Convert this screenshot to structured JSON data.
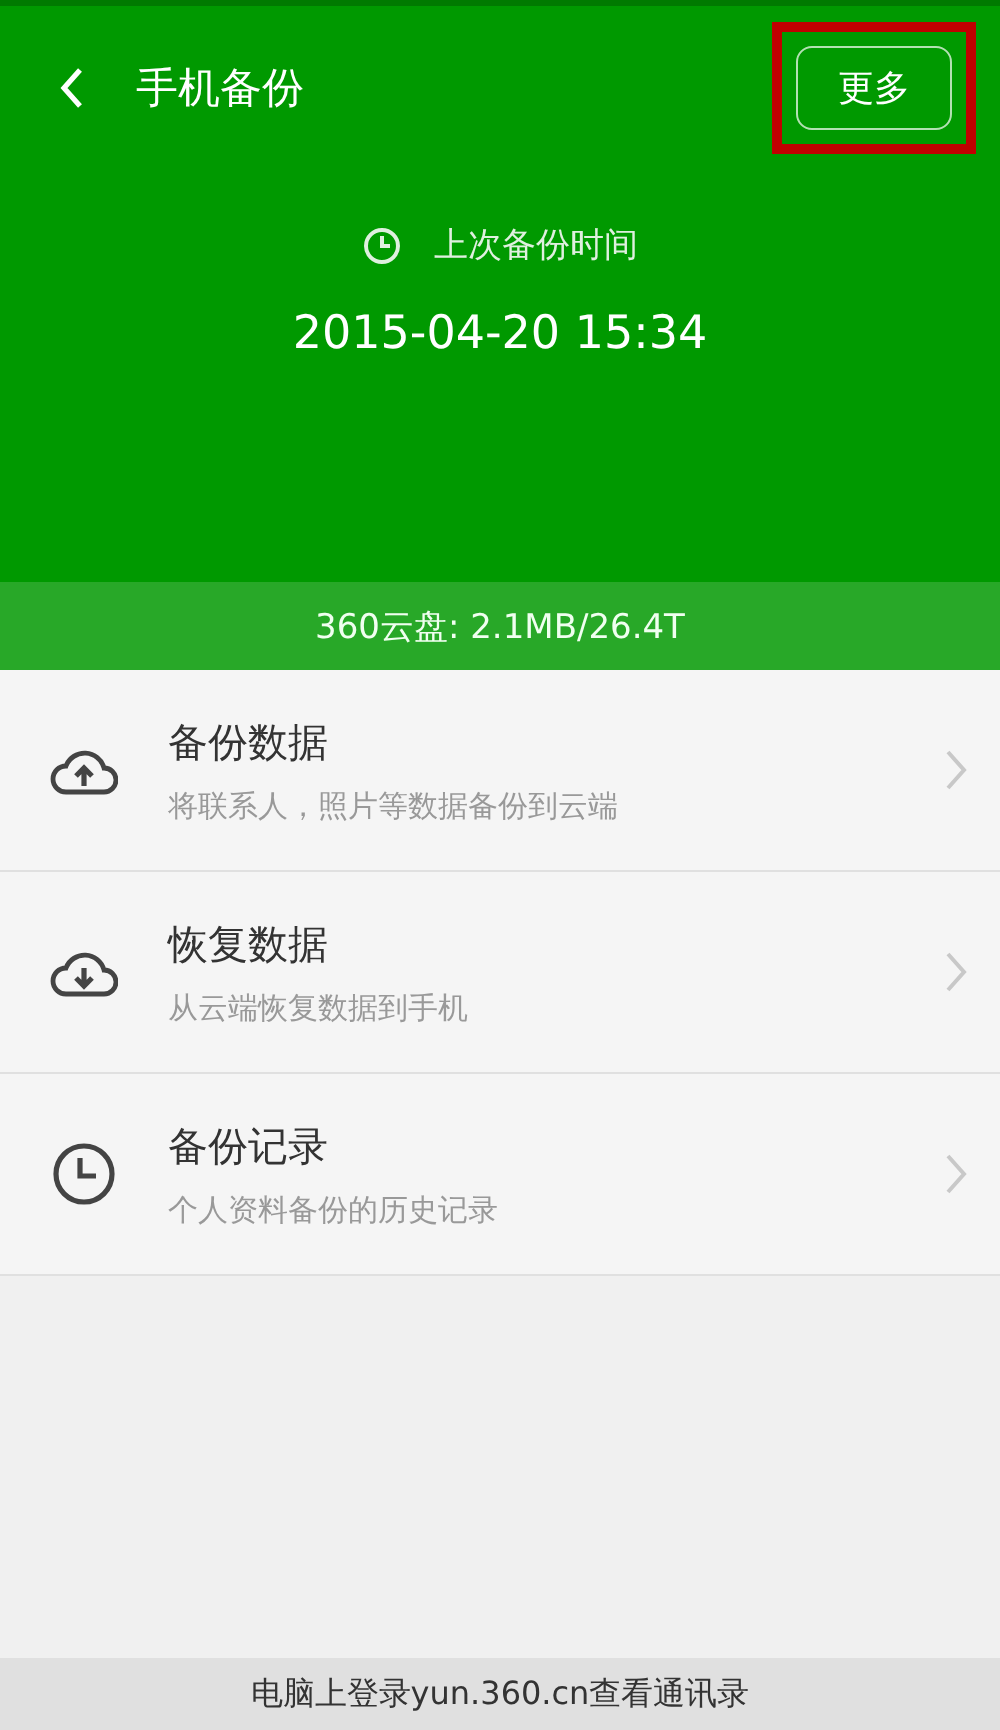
{
  "header": {
    "title": "手机备份",
    "more_button": "更多",
    "more_highlighted": true
  },
  "last_backup": {
    "label": "上次备份时间",
    "time": "2015-04-20 15:34"
  },
  "storage": "360云盘: 2.1MB/26.4T",
  "items": [
    {
      "kind": "upload",
      "title": "备份数据",
      "subtitle": "将联系人，照片等数据备份到云端"
    },
    {
      "kind": "download",
      "title": "恢复数据",
      "subtitle": "从云端恢复数据到手机"
    },
    {
      "kind": "history",
      "title": "备份记录",
      "subtitle": "个人资料备份的历史记录"
    }
  ],
  "footer": "电脑上登录yun.360.cn查看通讯录"
}
